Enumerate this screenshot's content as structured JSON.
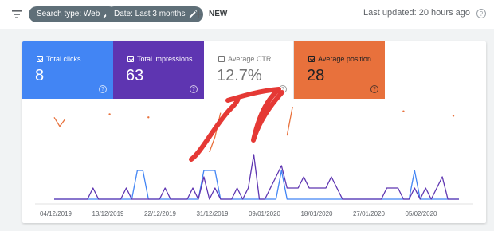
{
  "topbar": {
    "chips": [
      {
        "label": "Search type: Web"
      },
      {
        "label": "Date: Last 3 months"
      }
    ],
    "new_label": "NEW",
    "last_updated": "Last updated: 20 hours ago"
  },
  "metrics": [
    {
      "label": "Total clicks",
      "value": "8",
      "checked": true
    },
    {
      "label": "Total impressions",
      "value": "63",
      "checked": true
    },
    {
      "label": "Average CTR",
      "value": "12.7%",
      "checked": false
    },
    {
      "label": "Average position",
      "value": "28",
      "checked": true
    }
  ],
  "colors": {
    "clicks": "#4285f4",
    "impressions": "#5e35b1",
    "position": "#e8713c",
    "arrow": "#e53935"
  },
  "chart_data": {
    "type": "line",
    "x_tick_labels": [
      "04/12/2019",
      "13/12/2019",
      "22/12/2019",
      "31/12/2019",
      "09/01/2020",
      "18/01/2020",
      "27/01/2020",
      "05/02/2020"
    ],
    "series": [
      {
        "name": "Total clicks",
        "color": "#4285f4",
        "values": [
          0,
          0,
          0,
          0,
          0,
          0,
          0,
          0,
          0,
          0,
          0,
          0,
          0,
          0,
          0,
          1,
          1,
          0,
          0,
          0,
          0,
          0,
          0,
          0,
          0,
          0,
          0,
          1,
          1,
          1,
          0,
          0,
          0,
          0,
          0,
          0,
          0,
          0,
          0,
          0,
          0,
          1,
          0,
          0,
          0,
          0,
          0,
          0,
          0,
          0,
          0,
          0,
          0,
          0,
          0,
          0,
          0,
          0,
          0,
          0,
          0,
          0,
          0,
          0,
          0,
          1,
          0,
          0,
          0,
          0,
          0,
          0,
          0,
          0
        ]
      },
      {
        "name": "Total impressions",
        "color": "#5e35b1",
        "values": [
          0,
          0,
          0,
          0,
          0,
          0,
          0,
          1,
          0,
          0,
          0,
          0,
          0,
          1,
          0,
          0,
          0,
          0,
          0,
          0,
          1,
          0,
          0,
          0,
          0,
          1,
          0,
          2,
          0,
          1,
          0,
          0,
          0,
          1,
          0,
          1,
          4,
          0,
          0,
          1,
          2,
          3,
          1,
          1,
          1,
          2,
          1,
          1,
          1,
          1,
          2,
          1,
          0,
          0,
          0,
          0,
          0,
          0,
          0,
          0,
          1,
          1,
          1,
          0,
          0,
          1,
          0,
          1,
          0,
          1,
          2,
          0,
          0,
          0
        ]
      },
      {
        "name": "Average position",
        "color": "#e8713c",
        "values": [
          12,
          18,
          13,
          null,
          null,
          null,
          null,
          null,
          null,
          null,
          10,
          null,
          null,
          null,
          null,
          null,
          null,
          12,
          null,
          null,
          null,
          null,
          null,
          null,
          null,
          null,
          null,
          null,
          35,
          25,
          9,
          null,
          null,
          null,
          null,
          null,
          null,
          null,
          null,
          null,
          null,
          null,
          24,
          5,
          null,
          null,
          null,
          null,
          null,
          null,
          null,
          null,
          null,
          null,
          null,
          null,
          null,
          null,
          null,
          null,
          null,
          null,
          null,
          8,
          null,
          null,
          null,
          null,
          null,
          null,
          null,
          null,
          11,
          null
        ]
      }
    ]
  }
}
